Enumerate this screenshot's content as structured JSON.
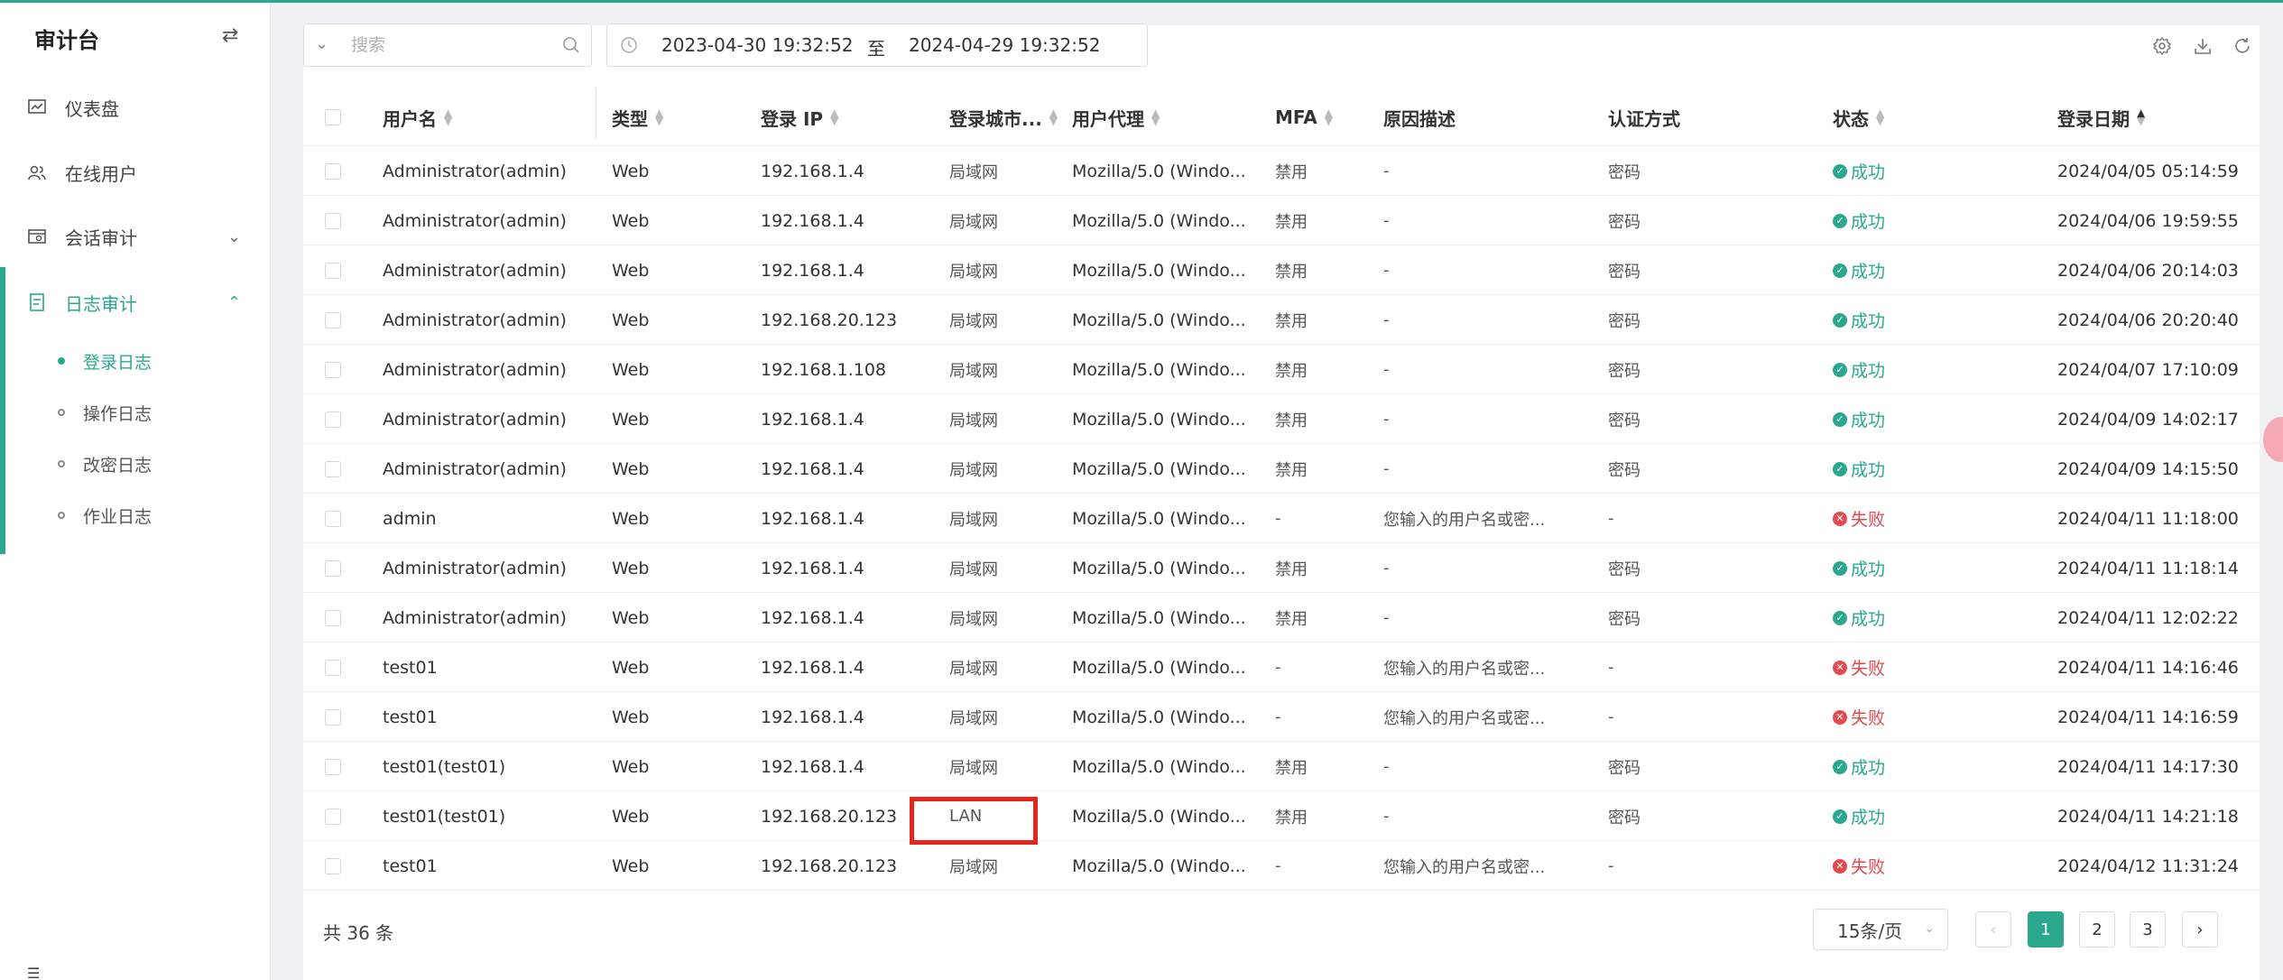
{
  "sidebar": {
    "title": "审计台",
    "items": [
      {
        "label": "仪表盘",
        "icon": "dashboard-icon"
      },
      {
        "label": "在线用户",
        "icon": "users-icon"
      },
      {
        "label": "会话审计",
        "icon": "session-icon"
      },
      {
        "label": "日志审计",
        "icon": "log-icon"
      }
    ],
    "sub_items": [
      {
        "label": "登录日志",
        "active": true
      },
      {
        "label": "操作日志",
        "active": false
      },
      {
        "label": "改密日志",
        "active": false
      },
      {
        "label": "作业日志",
        "active": false
      }
    ]
  },
  "search": {
    "placeholder": "搜索",
    "value": ""
  },
  "date_range": {
    "start": "2023-04-30 19:32:52",
    "separator": "至",
    "end": "2024-04-29 19:32:52"
  },
  "table": {
    "headers": {
      "user": "用户名",
      "type": "类型",
      "ip": "登录 IP",
      "city": "登录城市...",
      "agent": "用户代理",
      "mfa": "MFA",
      "reason": "原因描述",
      "auth": "认证方式",
      "status": "状态",
      "date": "登录日期"
    },
    "rows": [
      {
        "user": "Administrator(admin)",
        "type": "Web",
        "ip": "192.168.1.4",
        "city": "局域网",
        "agent": "Mozilla/5.0 (Windo...",
        "mfa": "禁用",
        "reason": "-",
        "auth": "密码",
        "status": "成功",
        "ok": true,
        "date": "2024/04/05 05:14:59"
      },
      {
        "user": "Administrator(admin)",
        "type": "Web",
        "ip": "192.168.1.4",
        "city": "局域网",
        "agent": "Mozilla/5.0 (Windo...",
        "mfa": "禁用",
        "reason": "-",
        "auth": "密码",
        "status": "成功",
        "ok": true,
        "date": "2024/04/06 19:59:55"
      },
      {
        "user": "Administrator(admin)",
        "type": "Web",
        "ip": "192.168.1.4",
        "city": "局域网",
        "agent": "Mozilla/5.0 (Windo...",
        "mfa": "禁用",
        "reason": "-",
        "auth": "密码",
        "status": "成功",
        "ok": true,
        "date": "2024/04/06 20:14:03"
      },
      {
        "user": "Administrator(admin)",
        "type": "Web",
        "ip": "192.168.20.123",
        "city": "局域网",
        "agent": "Mozilla/5.0 (Windo...",
        "mfa": "禁用",
        "reason": "-",
        "auth": "密码",
        "status": "成功",
        "ok": true,
        "date": "2024/04/06 20:20:40"
      },
      {
        "user": "Administrator(admin)",
        "type": "Web",
        "ip": "192.168.1.108",
        "city": "局域网",
        "agent": "Mozilla/5.0 (Windo...",
        "mfa": "禁用",
        "reason": "-",
        "auth": "密码",
        "status": "成功",
        "ok": true,
        "date": "2024/04/07 17:10:09"
      },
      {
        "user": "Administrator(admin)",
        "type": "Web",
        "ip": "192.168.1.4",
        "city": "局域网",
        "agent": "Mozilla/5.0 (Windo...",
        "mfa": "禁用",
        "reason": "-",
        "auth": "密码",
        "status": "成功",
        "ok": true,
        "date": "2024/04/09 14:02:17"
      },
      {
        "user": "Administrator(admin)",
        "type": "Web",
        "ip": "192.168.1.4",
        "city": "局域网",
        "agent": "Mozilla/5.0 (Windo...",
        "mfa": "禁用",
        "reason": "-",
        "auth": "密码",
        "status": "成功",
        "ok": true,
        "date": "2024/04/09 14:15:50"
      },
      {
        "user": "admin",
        "type": "Web",
        "ip": "192.168.1.4",
        "city": "局域网",
        "agent": "Mozilla/5.0 (Windo...",
        "mfa": "-",
        "reason": "您输入的用户名或密...",
        "auth": "-",
        "status": "失败",
        "ok": false,
        "date": "2024/04/11 11:18:00"
      },
      {
        "user": "Administrator(admin)",
        "type": "Web",
        "ip": "192.168.1.4",
        "city": "局域网",
        "agent": "Mozilla/5.0 (Windo...",
        "mfa": "禁用",
        "reason": "-",
        "auth": "密码",
        "status": "成功",
        "ok": true,
        "date": "2024/04/11 11:18:14"
      },
      {
        "user": "Administrator(admin)",
        "type": "Web",
        "ip": "192.168.1.4",
        "city": "局域网",
        "agent": "Mozilla/5.0 (Windo...",
        "mfa": "禁用",
        "reason": "-",
        "auth": "密码",
        "status": "成功",
        "ok": true,
        "date": "2024/04/11 12:02:22"
      },
      {
        "user": "test01",
        "type": "Web",
        "ip": "192.168.1.4",
        "city": "局域网",
        "agent": "Mozilla/5.0 (Windo...",
        "mfa": "-",
        "reason": "您输入的用户名或密...",
        "auth": "-",
        "status": "失败",
        "ok": false,
        "date": "2024/04/11 14:16:46"
      },
      {
        "user": "test01",
        "type": "Web",
        "ip": "192.168.1.4",
        "city": "局域网",
        "agent": "Mozilla/5.0 (Windo...",
        "mfa": "-",
        "reason": "您输入的用户名或密...",
        "auth": "-",
        "status": "失败",
        "ok": false,
        "date": "2024/04/11 14:16:59"
      },
      {
        "user": "test01(test01)",
        "type": "Web",
        "ip": "192.168.1.4",
        "city": "局域网",
        "agent": "Mozilla/5.0 (Windo...",
        "mfa": "禁用",
        "reason": "-",
        "auth": "密码",
        "status": "成功",
        "ok": true,
        "date": "2024/04/11 14:17:30"
      },
      {
        "user": "test01(test01)",
        "type": "Web",
        "ip": "192.168.20.123",
        "city": "LAN",
        "agent": "Mozilla/5.0 (Windo...",
        "mfa": "禁用",
        "reason": "-",
        "auth": "密码",
        "status": "成功",
        "ok": true,
        "date": "2024/04/11 14:21:18"
      },
      {
        "user": "test01",
        "type": "Web",
        "ip": "192.168.20.123",
        "city": "局域网",
        "agent": "Mozilla/5.0 (Windo...",
        "mfa": "-",
        "reason": "您输入的用户名或密...",
        "auth": "-",
        "status": "失败",
        "ok": false,
        "date": "2024/04/12 11:31:24"
      }
    ]
  },
  "footer": {
    "total": "共 36 条",
    "page_size": "15条/页",
    "pages": [
      "1",
      "2",
      "3"
    ],
    "current_page": "1"
  },
  "colors": {
    "accent": "#2aa88e",
    "fail": "#e5484d",
    "highlight": "#e5241b"
  }
}
